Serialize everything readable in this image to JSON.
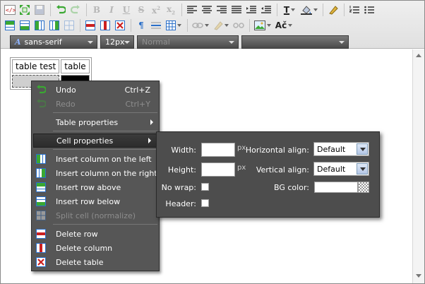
{
  "toolbar": {
    "font_family": "sans-serif",
    "font_size": "12px",
    "format_block": "Normal",
    "style_select": "",
    "text_color_glyph": "T",
    "spellcheck_glyph": "Ač"
  },
  "icons": {
    "row1": [
      "source-icon",
      "fullscreen-icon",
      "save-icon",
      "undo-icon",
      "redo-icon",
      "bold-icon",
      "italic-icon",
      "underline-icon",
      "strike-icon",
      "superscript-icon",
      "subscript-icon",
      "align-left-icon",
      "align-center-icon",
      "align-right-icon",
      "justify-icon",
      "indent-icon",
      "outdent-icon",
      "font-color-icon",
      "bg-color-icon",
      "clear-format-icon",
      "ordered-list-icon",
      "unordered-list-icon"
    ],
    "row2": [
      "insert-row-above-icon",
      "insert-row-below-icon",
      "insert-col-left-icon",
      "insert-col-right-icon",
      "split-cell-icon",
      "delete-row-icon",
      "delete-col-icon",
      "delete-table-icon",
      "paragraph-icon",
      "hr-icon",
      "table-icon",
      "link-icon",
      "anchor-icon",
      "unlink-icon",
      "image-icon",
      "spellcheck-icon"
    ]
  },
  "document": {
    "table": {
      "rows": [
        [
          "table test",
          "table"
        ],
        [
          "",
          ""
        ]
      ]
    }
  },
  "context_menu": {
    "items": [
      {
        "label": "Undo",
        "shortcut": "Ctrl+Z",
        "icon": "undo-icon",
        "disabled": false
      },
      {
        "label": "Redo",
        "shortcut": "Ctrl+Y",
        "icon": "redo-icon",
        "disabled": true
      },
      {
        "label": "Table properties",
        "icon": "",
        "submenu": true
      },
      {
        "label": "Cell properties",
        "icon": "",
        "submenu": true,
        "active": true
      },
      {
        "label": "Insert column on the left",
        "icon": "insert-col-left-icon"
      },
      {
        "label": "Insert column on the right",
        "icon": "insert-col-right-icon"
      },
      {
        "label": "Insert row above",
        "icon": "insert-row-above-icon"
      },
      {
        "label": "Insert row below",
        "icon": "insert-row-below-icon"
      },
      {
        "label": "Split cell (normalize)",
        "icon": "split-cell-icon",
        "disabled": true
      },
      {
        "label": "Delete row",
        "icon": "delete-row-icon"
      },
      {
        "label": "Delete column",
        "icon": "delete-col-icon"
      },
      {
        "label": "Delete table",
        "icon": "delete-table-icon"
      }
    ]
  },
  "cell_properties": {
    "width_label": "Width:",
    "width_value": "",
    "width_unit": "px",
    "height_label": "Height:",
    "height_value": "",
    "height_unit": "px",
    "nowrap_label": "No wrap:",
    "header_label": "Header:",
    "halign_label": "Horizontal align:",
    "halign_value": "Default",
    "valign_label": "Vertical align:",
    "valign_value": "Default",
    "bgcolor_label": "BG color:"
  },
  "colors": {
    "menu_bg": "#565656",
    "panel_bg": "#4d4d4d",
    "accent_blue": "#2a6fc9",
    "accent_green": "#3aa832",
    "accent_red": "#cc2020"
  }
}
